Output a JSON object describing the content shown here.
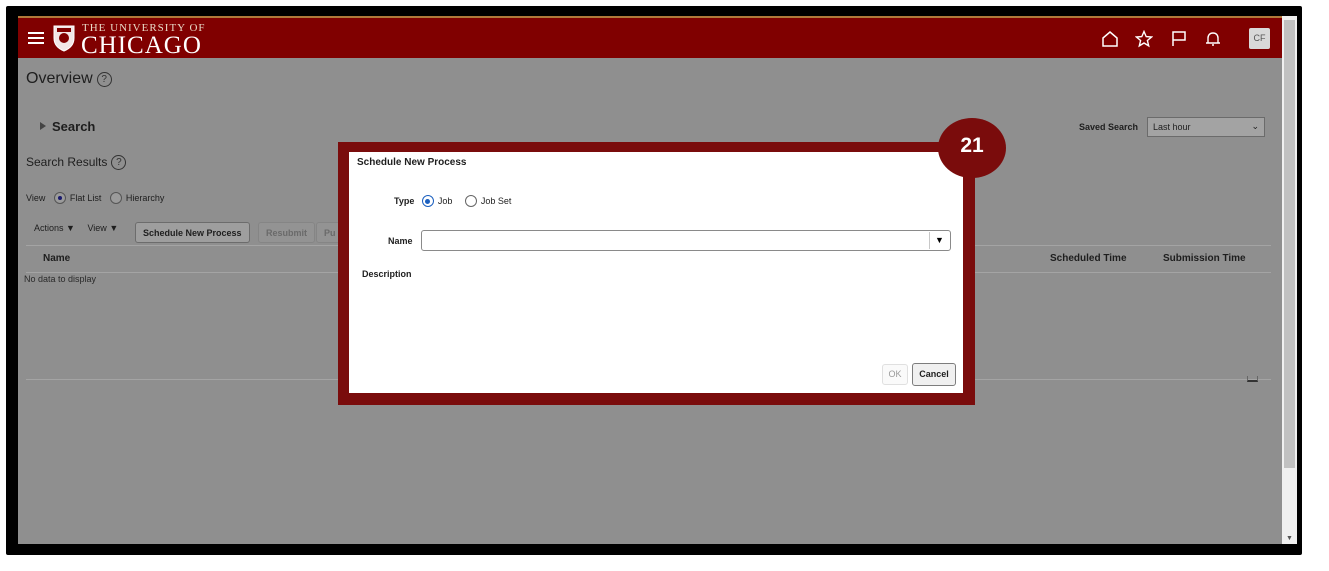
{
  "header": {
    "logo_line1": "THE UNIVERSITY OF",
    "logo_line2": "CHICAGO",
    "icons": [
      "home-icon",
      "favorite-star-icon",
      "flag-icon",
      "bell-icon"
    ],
    "avatar_initials": "CF",
    "brand_color": "#800000"
  },
  "page": {
    "title": "Overview",
    "search_label": "Search",
    "saved_search_label": "Saved Search",
    "saved_search_value": "Last hour",
    "results_title": "Search Results",
    "view_label": "View",
    "view_options": [
      "Flat List",
      "Hierarchy"
    ],
    "view_selected": "Flat List",
    "toolbar": {
      "actions": "Actions",
      "view": "View",
      "schedule": "Schedule New Process",
      "resubmit": "Resubmit",
      "put": "Pu"
    },
    "columns": {
      "name": "Name",
      "scheduled": "Scheduled Time",
      "submission": "Submission Time"
    },
    "no_data": "No data to display"
  },
  "dialog": {
    "title": "Schedule New Process",
    "type_label": "Type",
    "type_options": [
      "Job",
      "Job Set"
    ],
    "type_selected": "Job",
    "name_label": "Name",
    "name_value": "",
    "description_label": "Description",
    "ok": "OK",
    "cancel": "Cancel",
    "highlight_color": "#7a0c0c"
  },
  "step_number": "21"
}
